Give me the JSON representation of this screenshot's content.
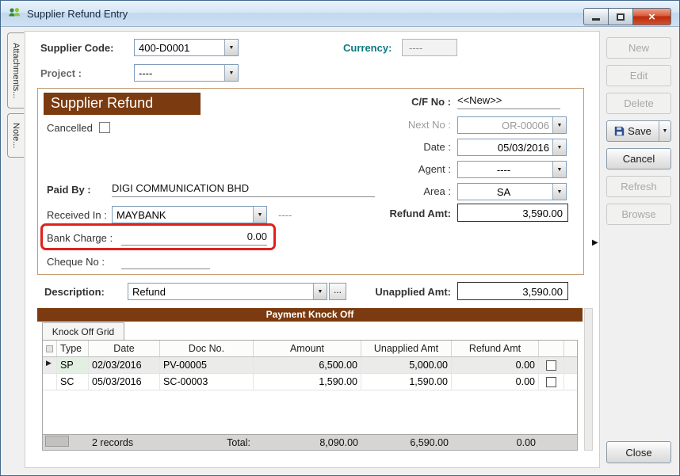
{
  "window": {
    "title": "Supplier Refund Entry"
  },
  "colors": {
    "brown": "#7b3a0f",
    "red": "#e2201c",
    "teal": "#0d7a80"
  },
  "icons": {
    "dropdown": "▼",
    "row_selector": "▶",
    "collapse": "▶",
    "close": "×",
    "ellipsis": "..."
  },
  "side_tabs": {
    "attachments": "Attachments...",
    "note": "Note..."
  },
  "action_buttons": {
    "new": "New",
    "edit": "Edit",
    "delete": "Delete",
    "save": "Save",
    "cancel": "Cancel",
    "refresh": "Refresh",
    "browse": "Browse",
    "close": "Close"
  },
  "form": {
    "supplier_code_label": "Supplier Code:",
    "supplier_code_value": "400-D0001",
    "currency_label": "Currency:",
    "currency_value": "----",
    "project_label": "Project :",
    "project_value": "----",
    "section_title": "Supplier Refund",
    "cancelled_label": "Cancelled",
    "cf_no_label": "C/F No :",
    "cf_no_value": "<<New>>",
    "next_no_label": "Next No :",
    "next_no_value": "OR-00006",
    "date_label": "Date :",
    "date_value": "05/03/2016",
    "agent_label": "Agent :",
    "agent_value": "----",
    "area_label": "Area :",
    "area_value": "SA",
    "refund_amt_label": "Refund Amt:",
    "refund_amt_value": "3,590.00",
    "paid_by_label": "Paid By :",
    "paid_by_value": "DIGI COMMUNICATION BHD",
    "received_in_label": "Received In :",
    "received_in_value": "MAYBANK",
    "received_in_extra": "----",
    "bank_charge_label": "Bank Charge :",
    "bank_charge_value": "0.00",
    "cheque_no_label": "Cheque No :",
    "description_label": "Description:",
    "description_value": "Refund",
    "unapplied_amt_label": "Unapplied Amt:",
    "unapplied_amt_value": "3,590.00"
  },
  "knock_off": {
    "header": "Payment Knock Off",
    "tab": "Knock Off Grid",
    "columns": [
      "Type",
      "Date",
      "Doc No.",
      "Amount",
      "Unapplied Amt",
      "Refund Amt"
    ],
    "rows": [
      {
        "type": "SP",
        "date": "02/03/2016",
        "doc_no": "PV-00005",
        "amount": "6,500.00",
        "unapplied_amt": "5,000.00",
        "refund_amt": "0.00"
      },
      {
        "type": "SC",
        "date": "05/03/2016",
        "doc_no": "SC-00003",
        "amount": "1,590.00",
        "unapplied_amt": "1,590.00",
        "refund_amt": "0.00"
      }
    ],
    "footer": {
      "records": "2 records",
      "total_label": "Total:",
      "total_amount": "8,090.00",
      "total_unapplied": "6,590.00",
      "total_refund": "0.00"
    }
  }
}
